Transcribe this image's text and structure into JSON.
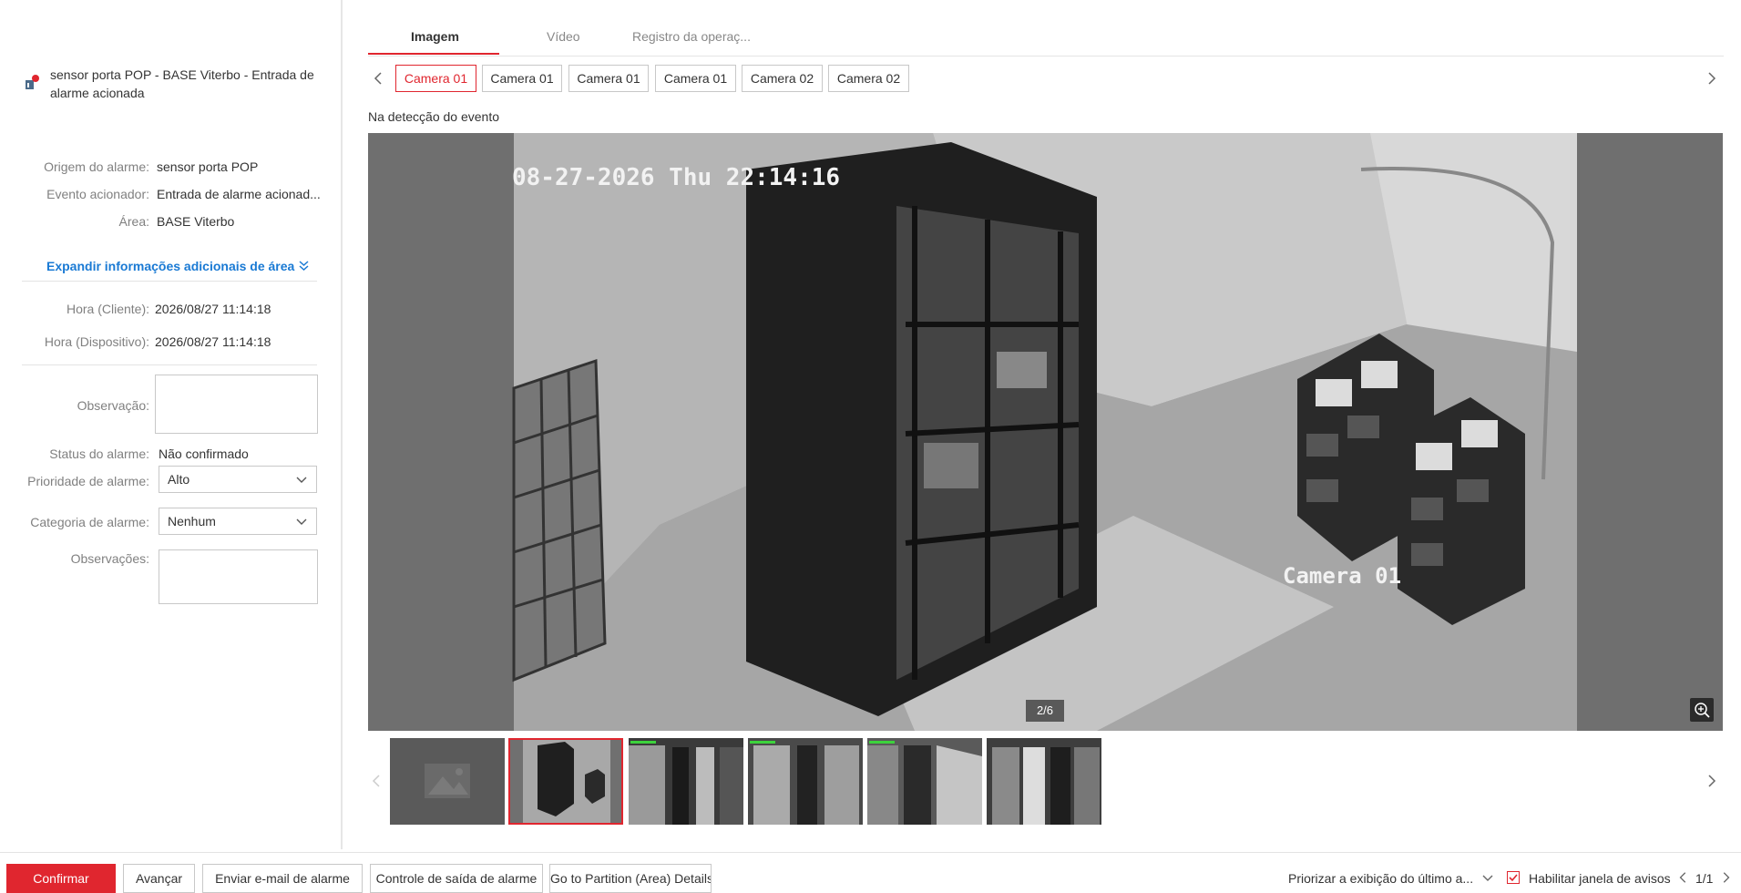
{
  "alarm": {
    "title": "sensor porta POP - BASE Viterbo - Entrada de alarme acionada",
    "icon": "alarm-sensor-icon"
  },
  "details": {
    "origin_label": "Origem do alarme:",
    "origin_value": "sensor porta POP",
    "event_label": "Evento acionador:",
    "event_value": "Entrada de alarme acionad...",
    "area_label": "Área:",
    "area_value": "BASE Viterbo",
    "expand_link": "Expandir informações adicionais de área",
    "client_time_label": "Hora (Cliente):",
    "client_time_value": "2026/08/27 11:14:18",
    "device_time_label": "Hora (Dispositivo):",
    "device_time_value": "2026/08/27 11:14:18",
    "observation_label": "Observação:",
    "status_label": "Status do alarme:",
    "status_value": "Não confirmado",
    "priority_label": "Prioridade de alarme:",
    "priority_value": "Alto",
    "category_label": "Categoria de alarme:",
    "category_value": "Nenhum",
    "remarks_label": "Observações:"
  },
  "tabs": [
    {
      "label": "Imagem",
      "active": true
    },
    {
      "label": "Vídeo",
      "active": false
    },
    {
      "label": "Registro da operaç...",
      "active": false
    }
  ],
  "cameras": [
    {
      "label": "Camera 01",
      "active": true
    },
    {
      "label": "Camera 01",
      "active": false
    },
    {
      "label": "Camera 01",
      "active": false
    },
    {
      "label": "Camera 01",
      "active": false
    },
    {
      "label": "Camera 02",
      "active": false
    },
    {
      "label": "Camera 02",
      "active": false
    }
  ],
  "viewer": {
    "caption": "Na detecção do evento",
    "osd_time": "08-27-2026 Thu 22:14:16",
    "osd_camera": "Camera 01",
    "page_indicator": "2/6"
  },
  "thumbnails": {
    "count": 6,
    "active_index": 1
  },
  "footer": {
    "confirm": "Confirmar",
    "forward": "Avançar",
    "send_email": "Enviar e-mail de alarme",
    "output_control": "Controle de saída de alarme",
    "partition_details": "Go to Partition (Area) Details",
    "priority_display": "Priorizar a exibição do último a...",
    "enable_popup": "Habilitar janela de avisos",
    "page": "1/1"
  },
  "colors": {
    "accent": "#e0262f",
    "link": "#1a7ad4"
  }
}
